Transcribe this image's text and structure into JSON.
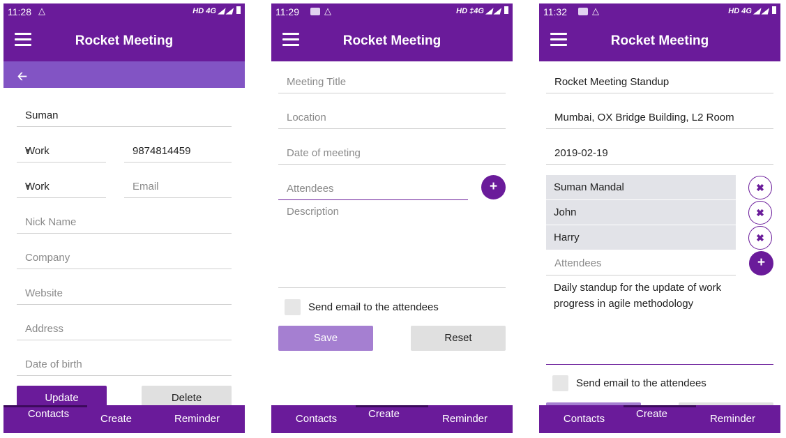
{
  "status": [
    {
      "time": "11:28",
      "right": "HD 4G"
    },
    {
      "time": "11:29",
      "right": "HD ‡4G"
    },
    {
      "time": "11:32",
      "right": "HD 4G"
    }
  ],
  "app_title": "Rocket Meeting",
  "icons": {
    "menu": "hamburger-icon",
    "back": "arrow-left-icon",
    "add": "plus-icon",
    "remove": "close-icon"
  },
  "colors": {
    "primary": "#6a1b9a",
    "subbar": "#8254c4",
    "chip": "#e2e3e8"
  },
  "contact_form": {
    "name": "Suman",
    "phone_type": "Work",
    "phone": "9874814459",
    "email_type": "Work",
    "email_placeholder": "Email",
    "nick_name_placeholder": "Nick Name",
    "company_placeholder": "Company",
    "website_placeholder": "Website",
    "address_placeholder": "Address",
    "dob_placeholder": "Date of birth",
    "update_label": "Update",
    "delete_label": "Delete"
  },
  "meeting_form": {
    "title_placeholder": "Meeting Title",
    "location_placeholder": "Location",
    "date_placeholder": "Date of meeting",
    "attendees_placeholder": "Attendees",
    "description_placeholder": "Description",
    "send_email_label": "Send email to the attendees",
    "save_label": "Save",
    "reset_label": "Reset"
  },
  "meeting_filled": {
    "title": "Rocket Meeting Standup",
    "location": "Mumbai, OX Bridge Building, L2 Room",
    "date": "2019-02-19",
    "attendees": [
      "Suman Mandal",
      "John",
      "Harry"
    ],
    "attendees_placeholder": "Attendees",
    "description": "Daily standup for the update of work progress in agile methodology",
    "send_email_label": "Send email to the attendees"
  },
  "nav": {
    "contacts": "Contacts",
    "create": "Create",
    "reminder": "Reminder"
  }
}
